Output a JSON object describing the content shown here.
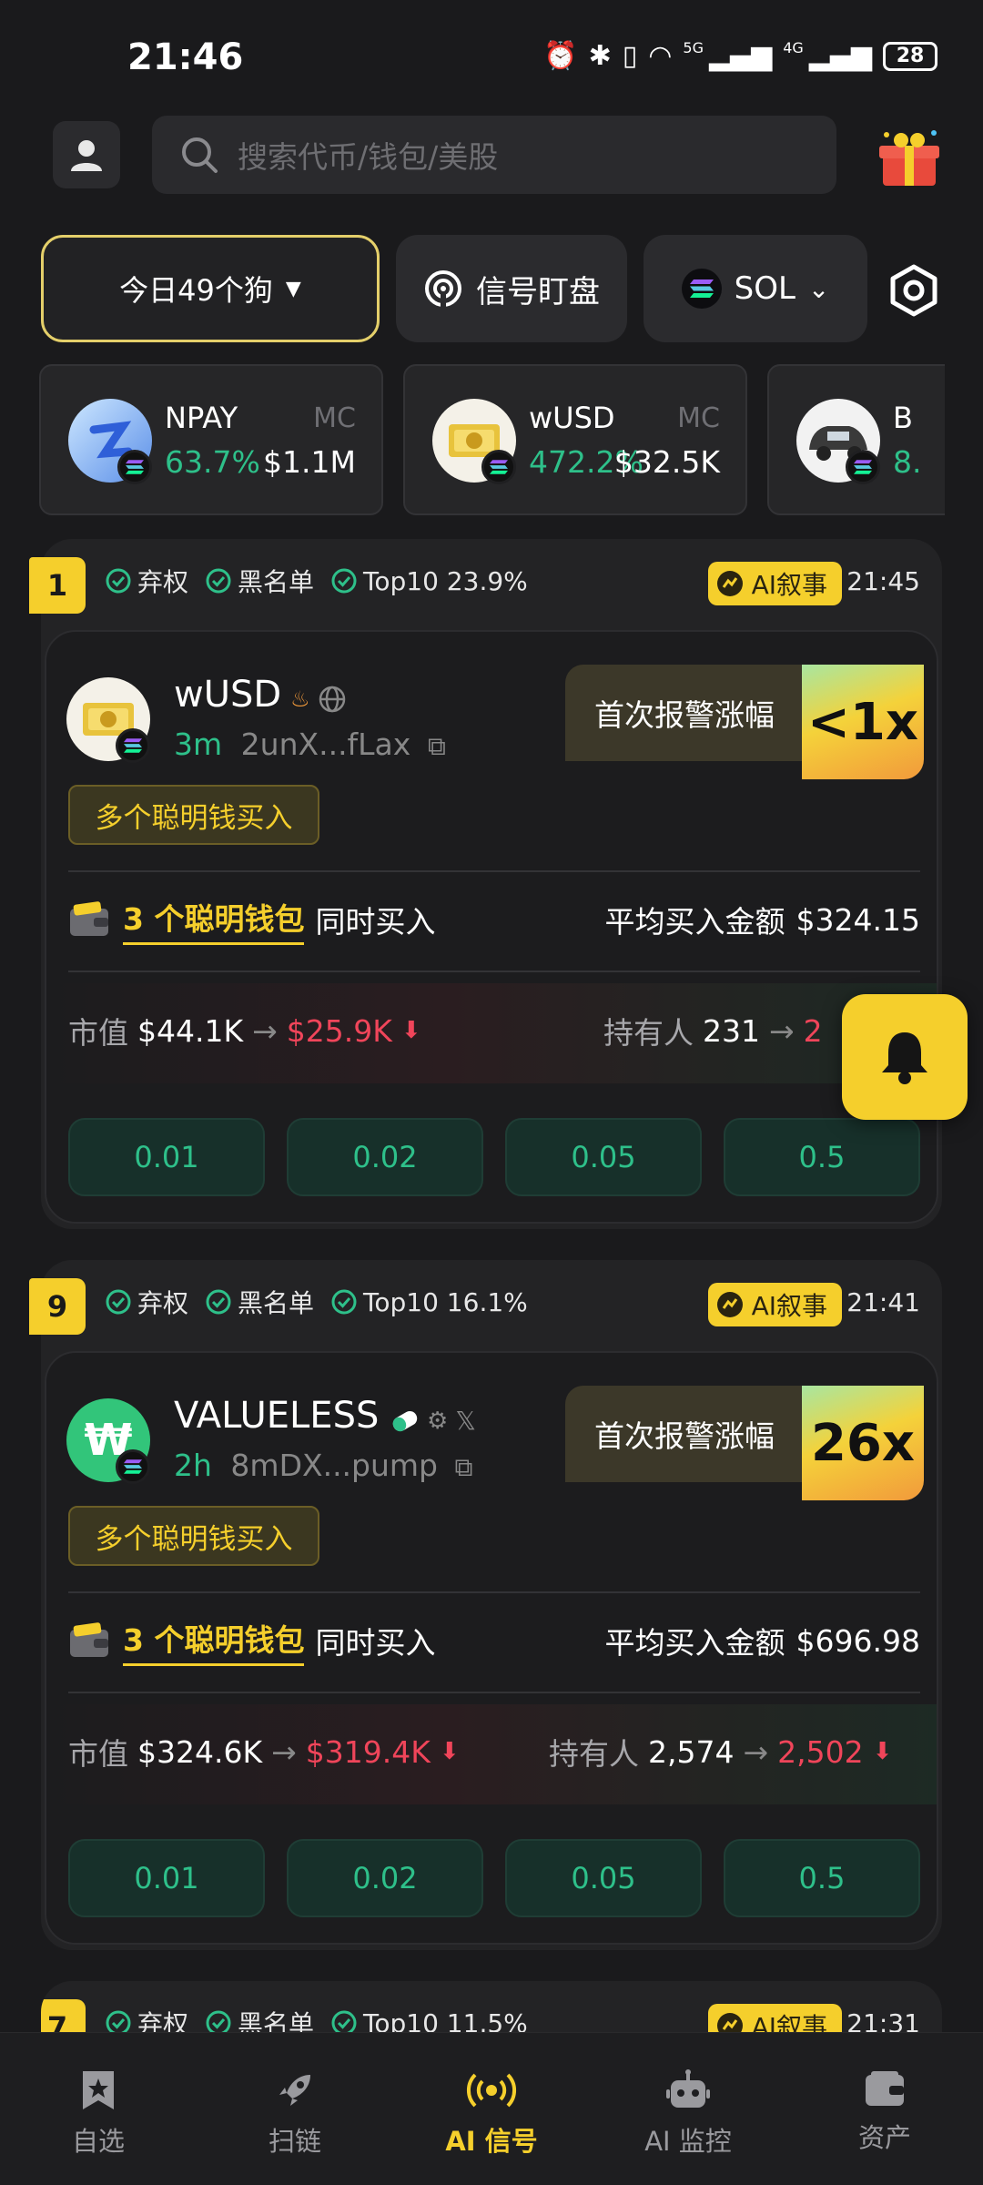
{
  "status_bar": {
    "time": "21:46",
    "network_5g": "5G",
    "network_4g": "4G",
    "battery": "28"
  },
  "search": {
    "placeholder": "搜索代币/钱包/美股"
  },
  "filters": {
    "dogs": "今日49个狗",
    "signal": "信号盯盘",
    "chain": "SOL"
  },
  "tokens": [
    {
      "name": "NPAY",
      "mc_label": "MC",
      "change": "63.7%",
      "mc": "$1.1M"
    },
    {
      "name": "wUSD",
      "mc_label": "MC",
      "change": "472.2%",
      "mc": "$32.5K"
    },
    {
      "name": "B",
      "mc_label": "",
      "change": "8.",
      "mc": ""
    }
  ],
  "cards": [
    {
      "rank": "1",
      "check1": "弃权",
      "check2": "黑名单",
      "check3": "Top10 23.9%",
      "ai_tag": "AI叙事",
      "time": "21:45",
      "token_name": "wUSD",
      "age": "3m",
      "address": "2unX...fLax",
      "smart_tag": "多个聪明钱买入",
      "alert_label": "首次报警涨幅",
      "alert_mult": "<1x",
      "wallet_count": "3 个聪明钱包",
      "wallet_suffix": "同时买入",
      "avg_label": "平均买入金额",
      "avg_value": "$324.15",
      "mcap_label": "市值",
      "mcap_from": "$44.1K",
      "mcap_to": "$25.9K",
      "holders_label": "持有人",
      "holders_from": "231",
      "holders_to": "2",
      "buy_options": [
        "0.01",
        "0.02",
        "0.05",
        "0.5"
      ]
    },
    {
      "rank": "9",
      "check1": "弃权",
      "check2": "黑名单",
      "check3": "Top10 16.1%",
      "ai_tag": "AI叙事",
      "time": "21:41",
      "token_name": "VALUELESS",
      "age": "2h",
      "address": "8mDX...pump",
      "smart_tag": "多个聪明钱买入",
      "alert_label": "首次报警涨幅",
      "alert_mult": "26x",
      "wallet_count": "3 个聪明钱包",
      "wallet_suffix": "同时买入",
      "avg_label": "平均买入金额",
      "avg_value": "$696.98",
      "mcap_label": "市值",
      "mcap_from": "$324.6K",
      "mcap_to": "$319.4K",
      "holders_label": "持有人",
      "holders_from": "2,574",
      "holders_to": "2,502",
      "buy_options": [
        "0.01",
        "0.02",
        "0.05",
        "0.5"
      ]
    },
    {
      "rank": "7",
      "check1": "弃权",
      "check2": "黑名单",
      "check3": "Top10 11.5%",
      "ai_tag": "AI叙事",
      "time": "21:31"
    }
  ],
  "nav": {
    "watchlist": "自选",
    "scan": "扫链",
    "ai_signal": "AI 信号",
    "ai_monitor": "AI 监控",
    "assets": "资产"
  },
  "colors": {
    "accent": "#f5cf2c",
    "green": "#2ec08a",
    "red": "#f0455a",
    "background": "#1a1a1c"
  }
}
